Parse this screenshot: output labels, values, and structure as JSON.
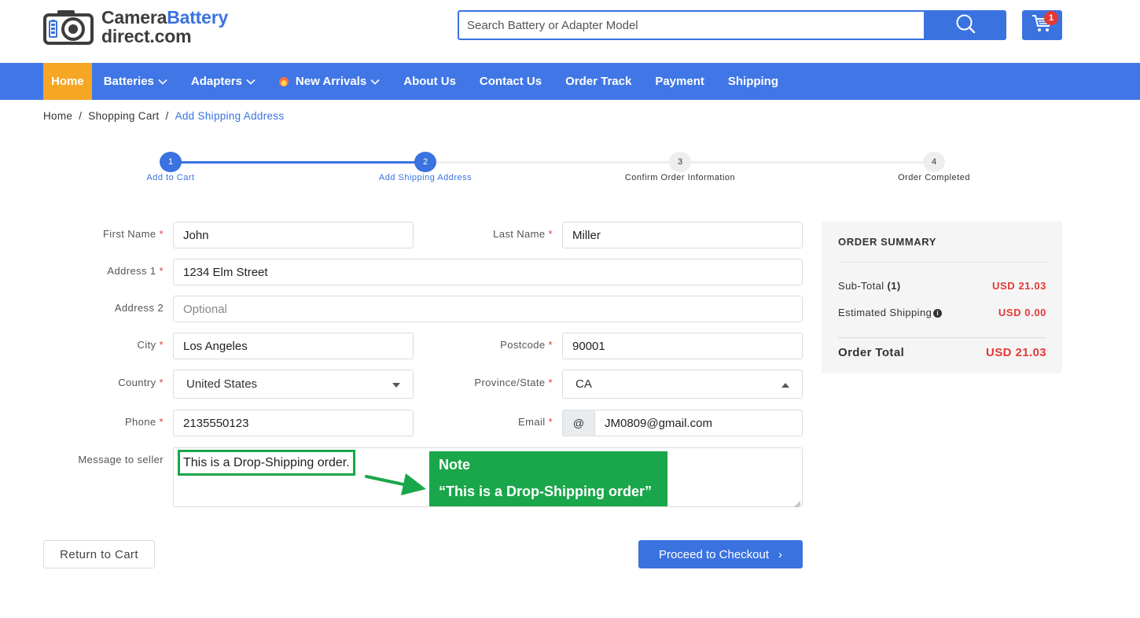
{
  "brand": {
    "logo_line1_a": "Camera",
    "logo_line1_b": "Battery",
    "logo_line2": "direct.com"
  },
  "search": {
    "placeholder": "Search Battery or Adapter Model"
  },
  "cart": {
    "count": "1"
  },
  "nav": {
    "items": [
      {
        "label": "Home"
      },
      {
        "label": "Batteries"
      },
      {
        "label": "Adapters"
      },
      {
        "label": "New Arrivals"
      },
      {
        "label": "About Us"
      },
      {
        "label": "Contact Us"
      },
      {
        "label": "Order Track"
      },
      {
        "label": "Payment"
      },
      {
        "label": "Shipping"
      }
    ]
  },
  "breadcrumb": {
    "home": "Home",
    "sep": "/",
    "cart": "Shopping Cart",
    "current": "Add Shipping Address"
  },
  "steps": [
    {
      "num": "1",
      "label": "Add to Cart",
      "done": true
    },
    {
      "num": "2",
      "label": "Add Shipping Address",
      "done": true
    },
    {
      "num": "3",
      "label": "Confirm Order Information",
      "done": false
    },
    {
      "num": "4",
      "label": "Order Completed",
      "done": false
    }
  ],
  "form": {
    "first_name_label": "First Name",
    "first_name": "John",
    "last_name_label": "Last Name",
    "last_name": "Miller",
    "address1_label": "Address 1",
    "address1": "1234 Elm Street",
    "address2_label": "Address 2",
    "address2_placeholder": "Optional",
    "city_label": "City",
    "city": "Los Angeles",
    "postcode_label": "Postcode",
    "postcode": "90001",
    "country_label": "Country",
    "country": "United States",
    "province_label": "Province/State",
    "province": "CA",
    "phone_label": "Phone",
    "phone": "2135550123",
    "email_label": "Email",
    "email_addon": "@",
    "email": "JM0809@gmail.com",
    "message_label": "Message to seller",
    "message": "This is a Drop-Shipping order.",
    "required_mark": "*"
  },
  "note": {
    "title": "Note",
    "text": "“This is a Drop-Shipping order”"
  },
  "buttons": {
    "return": "Return to Cart",
    "proceed": "Proceed to Checkout",
    "proceed_icon": "›"
  },
  "summary": {
    "title": "ORDER SUMMARY",
    "subtotal_label": "Sub-Total",
    "subtotal_count": "(1)",
    "subtotal_value": "USD 21.03",
    "shipping_label": "Estimated Shipping",
    "shipping_value": "USD 0.00",
    "total_label": "Order Total",
    "total_value": "USD 21.03"
  },
  "colors": {
    "primary": "#3a72e0",
    "nav": "#4076e6",
    "home_active": "#f5a623",
    "price_red": "#e53935",
    "note_green": "#1aa64a"
  }
}
